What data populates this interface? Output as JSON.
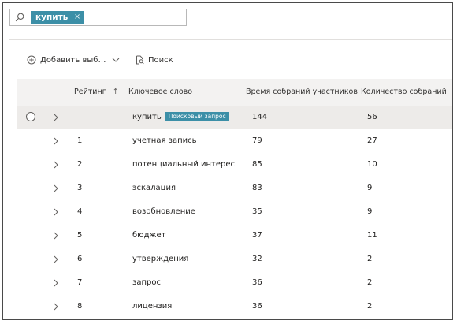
{
  "search": {
    "chip_label": "купить",
    "chip_close": "×"
  },
  "toolbar": {
    "add_label": "Добавить выб…",
    "search_label": "Поиск"
  },
  "table": {
    "columns": {
      "rank": "Рейтинг",
      "sort_arrow": "↑",
      "keyword": "Ключевое слово",
      "time": "Время собраний участников",
      "count": "Количество собраний"
    },
    "query_badge": "Поисковый запрос",
    "rows": [
      {
        "rank": "",
        "keyword": "купить",
        "time": "144",
        "count": "56"
      },
      {
        "rank": "1",
        "keyword": "учетная запись",
        "time": "79",
        "count": "27"
      },
      {
        "rank": "2",
        "keyword": "потенциальный интерес",
        "time": "85",
        "count": "10"
      },
      {
        "rank": "3",
        "keyword": "эскалация",
        "time": "83",
        "count": "9"
      },
      {
        "rank": "4",
        "keyword": "возобновление",
        "time": "35",
        "count": "9"
      },
      {
        "rank": "5",
        "keyword": "бюджет",
        "time": "37",
        "count": "11"
      },
      {
        "rank": "6",
        "keyword": "утверждения",
        "time": "32",
        "count": "2"
      },
      {
        "rank": "7",
        "keyword": "запрос",
        "time": "36",
        "count": "2"
      },
      {
        "rank": "8",
        "keyword": "лицензия",
        "time": "36",
        "count": "2"
      }
    ]
  },
  "colors": {
    "accent": "#3c8fa7",
    "header_bg": "#f3f2f1",
    "selected_bg": "#edebe9"
  }
}
